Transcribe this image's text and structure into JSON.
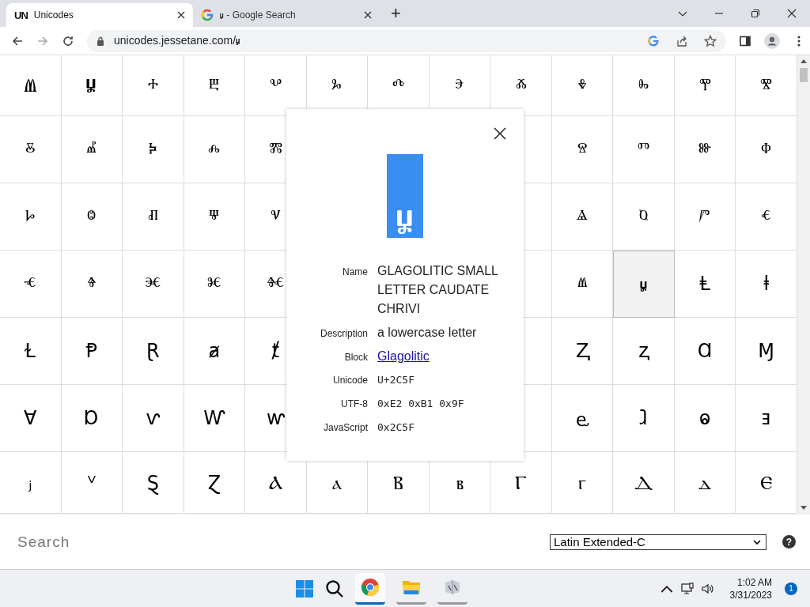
{
  "tabs": [
    {
      "title": "Unicodes",
      "icon_text": "UN",
      "kind": "site",
      "selected": true
    },
    {
      "title": "ⱟ - Google Search",
      "kind": "google",
      "selected": false
    }
  ],
  "new_tab": "+",
  "address": "unicodes.jessetane.com/ⱟ",
  "grid": [
    {
      "cells": [
        {
          "kind": "glyph",
          "char": "Ⱞ",
          "selected": false
        },
        {
          "kind": "glyph",
          "char": "Ⱟ",
          "selected": false
        },
        {
          "kind": "glyph",
          "char": "ⰰ",
          "selected": false
        },
        {
          "kind": "glyph",
          "char": "ⰱ",
          "selected": false
        },
        {
          "kind": "glyph",
          "char": "ⰲ",
          "selected": false
        },
        {
          "kind": "glyph",
          "char": "ⰳ",
          "selected": false
        },
        {
          "kind": "glyph",
          "char": "ⰴ",
          "selected": false
        },
        {
          "kind": "glyph",
          "char": "ⰵ",
          "selected": false
        },
        {
          "kind": "glyph",
          "char": "ⰶ",
          "selected": false
        },
        {
          "kind": "glyph",
          "char": "ⰷ",
          "selected": false
        },
        {
          "kind": "glyph",
          "char": "ⰸ",
          "selected": false
        },
        {
          "kind": "glyph",
          "char": "ⰹ",
          "selected": false
        },
        {
          "kind": "glyph",
          "char": "ⰺ",
          "selected": false
        }
      ]
    },
    {
      "cells": [
        {
          "kind": "glyph",
          "char": "ⰻ",
          "selected": false
        },
        {
          "kind": "glyph",
          "char": "ⰼ",
          "selected": false
        },
        {
          "kind": "glyph",
          "char": "ⰽ",
          "selected": false
        },
        {
          "kind": "glyph",
          "char": "ⰾ",
          "selected": false
        },
        {
          "kind": "glyph",
          "char": "ⰿ",
          "selected": false
        },
        {
          "kind": "hidden"
        },
        {
          "kind": "hidden"
        },
        {
          "kind": "hidden"
        },
        {
          "kind": "covered"
        },
        {
          "kind": "glyph",
          "char": "ⱄ",
          "selected": false
        },
        {
          "kind": "glyph",
          "char": "ⱅ",
          "selected": false
        },
        {
          "kind": "glyph",
          "char": "ⱆ",
          "selected": false
        },
        {
          "kind": "glyph",
          "char": "ⱇ",
          "selected": false
        }
      ]
    },
    {
      "cells": [
        {
          "kind": "glyph",
          "char": "ⱈ",
          "selected": false
        },
        {
          "kind": "glyph",
          "char": "ⱉ",
          "selected": false
        },
        {
          "kind": "glyph",
          "char": "ⱊ",
          "selected": false
        },
        {
          "kind": "glyph",
          "char": "ⱋ",
          "selected": false
        },
        {
          "kind": "glyph",
          "char": "ⱌ",
          "selected": false
        },
        {
          "kind": "hidden"
        },
        {
          "kind": "hidden"
        },
        {
          "kind": "hidden"
        },
        {
          "kind": "covered"
        },
        {
          "kind": "glyph",
          "char": "ⱑ",
          "selected": false
        },
        {
          "kind": "glyph",
          "char": "ⱒ",
          "selected": false
        },
        {
          "kind": "glyph",
          "char": "ⱓ",
          "selected": false
        },
        {
          "kind": "glyph",
          "char": "ⱔ",
          "selected": false
        }
      ]
    },
    {
      "cells": [
        {
          "kind": "glyph",
          "char": "ⱕ",
          "selected": false
        },
        {
          "kind": "glyph",
          "char": "ⱖ",
          "selected": false
        },
        {
          "kind": "glyph",
          "char": "ⱗ",
          "selected": false
        },
        {
          "kind": "glyph",
          "char": "ⱘ",
          "selected": false
        },
        {
          "kind": "glyph",
          "char": "ⱙ",
          "selected": false
        },
        {
          "kind": "hidden"
        },
        {
          "kind": "hidden"
        },
        {
          "kind": "hidden"
        },
        {
          "kind": "covered"
        },
        {
          "kind": "glyph",
          "char": "ⱞ",
          "selected": false
        },
        {
          "kind": "glyph",
          "char": "ⱟ",
          "selected": true
        },
        {
          "kind": "glyph",
          "char": "Ⱡ",
          "selected": false
        },
        {
          "kind": "glyph",
          "char": "ⱡ",
          "selected": false
        }
      ]
    },
    {
      "cells": [
        {
          "kind": "glyph",
          "char": "Ɫ",
          "selected": false
        },
        {
          "kind": "glyph",
          "char": "Ᵽ",
          "selected": false
        },
        {
          "kind": "glyph",
          "char": "Ɽ",
          "selected": false
        },
        {
          "kind": "glyph",
          "char": "ⱥ",
          "selected": false
        },
        {
          "kind": "glyph",
          "char": "ⱦ",
          "selected": false
        },
        {
          "kind": "hidden"
        },
        {
          "kind": "hidden"
        },
        {
          "kind": "hidden"
        },
        {
          "kind": "covered"
        },
        {
          "kind": "glyph",
          "char": "Ⱬ",
          "selected": false
        },
        {
          "kind": "glyph",
          "char": "ⱬ",
          "selected": false
        },
        {
          "kind": "glyph",
          "char": "Ɑ",
          "selected": false
        },
        {
          "kind": "glyph",
          "char": "Ɱ",
          "selected": false
        }
      ]
    },
    {
      "cells": [
        {
          "kind": "glyph",
          "char": "Ɐ",
          "selected": false
        },
        {
          "kind": "glyph",
          "char": "Ɒ",
          "selected": false
        },
        {
          "kind": "glyph",
          "char": "ⱱ",
          "selected": false
        },
        {
          "kind": "glyph",
          "char": "Ⱳ",
          "selected": false
        },
        {
          "kind": "glyph",
          "char": "ⱳ",
          "selected": false
        },
        {
          "kind": "hidden"
        },
        {
          "kind": "hidden"
        },
        {
          "kind": "hidden"
        },
        {
          "kind": "covered"
        },
        {
          "kind": "glyph",
          "char": "ⱸ",
          "selected": false
        },
        {
          "kind": "glyph",
          "char": "ⱹ",
          "selected": false
        },
        {
          "kind": "glyph",
          "char": "ⱺ",
          "selected": false
        },
        {
          "kind": "glyph",
          "char": "ⱻ",
          "selected": false
        }
      ]
    },
    {
      "cells": [
        {
          "kind": "glyph",
          "char": "ⱼ",
          "selected": false
        },
        {
          "kind": "glyph",
          "char": "ⱽ",
          "selected": false
        },
        {
          "kind": "glyph",
          "char": "Ȿ",
          "selected": false
        },
        {
          "kind": "glyph",
          "char": "Ɀ",
          "selected": false
        },
        {
          "kind": "glyph",
          "char": "Ⲁ",
          "selected": false
        },
        {
          "kind": "glyph",
          "char": "ⲁ",
          "selected": false
        },
        {
          "kind": "glyph",
          "char": "Ⲃ",
          "selected": false
        },
        {
          "kind": "glyph",
          "char": "ⲃ",
          "selected": false
        },
        {
          "kind": "glyph",
          "char": "Ⲅ",
          "selected": false
        },
        {
          "kind": "glyph",
          "char": "ⲅ",
          "selected": false
        },
        {
          "kind": "glyph",
          "char": "Ⲇ",
          "selected": false
        },
        {
          "kind": "glyph",
          "char": "ⲇ",
          "selected": false
        },
        {
          "kind": "glyph",
          "char": "Ⲉ",
          "selected": false
        }
      ]
    }
  ],
  "detail": {
    "preview": "ⱟ",
    "fields": [
      {
        "label": "Name",
        "value": "GLAGOLITIC SMALL LETTER CAUDATE CHRIVI",
        "kind": "text"
      },
      {
        "label": "Description",
        "value": "a lowercase letter",
        "kind": "text"
      },
      {
        "label": "Block",
        "value": "Glagolitic",
        "kind": "link"
      },
      {
        "label": "Unicode",
        "value": "U+2C5F",
        "kind": "code"
      },
      {
        "label": "UTF-8",
        "value": "0xE2 0xB1 0x9F",
        "kind": "code"
      },
      {
        "label": "JavaScript",
        "value": "0x2C5F",
        "kind": "code"
      }
    ]
  },
  "search": {
    "placeholder": "Search"
  },
  "block_select": "Latin Extended-C",
  "help": "?",
  "taskbar": {
    "time": "1:02 AM",
    "date": "3/31/2023",
    "notifications": "1"
  }
}
